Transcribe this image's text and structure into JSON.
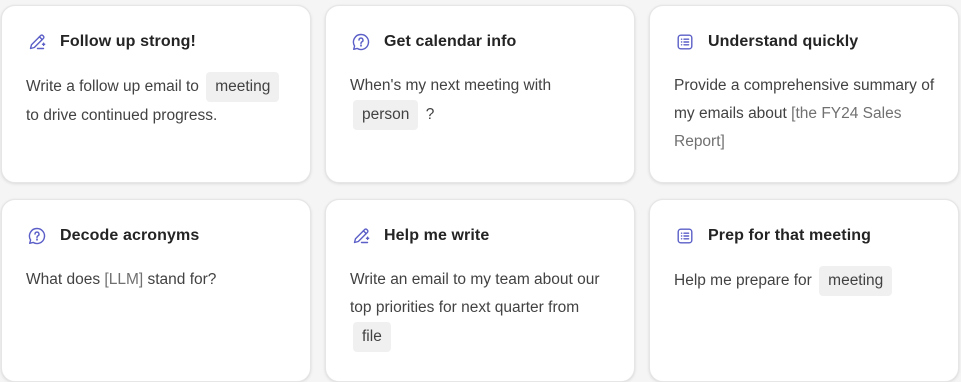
{
  "cards": [
    {
      "icon": "pen-sparkle-icon",
      "title": "Follow up strong!",
      "segments": [
        {
          "type": "text",
          "value": "Write a follow up email to"
        },
        {
          "type": "chip",
          "value": "meeting"
        },
        {
          "type": "text",
          "value": "to drive continued progress."
        }
      ]
    },
    {
      "icon": "chat-help-icon",
      "title": "Get calendar info",
      "segments": [
        {
          "type": "text",
          "value": "When's my next meeting with"
        },
        {
          "type": "chip",
          "value": "person"
        },
        {
          "type": "text",
          "value": "?"
        }
      ]
    },
    {
      "icon": "list-document-icon",
      "title": "Understand quickly",
      "segments": [
        {
          "type": "text",
          "value": "Provide a comprehensive summary of my emails about"
        },
        {
          "type": "placeholder",
          "value": "[the FY24 Sales Report]"
        }
      ]
    },
    {
      "icon": "chat-help-icon",
      "title": "Decode acronyms",
      "segments": [
        {
          "type": "text",
          "value": "What does"
        },
        {
          "type": "placeholder",
          "value": "[LLM]"
        },
        {
          "type": "text",
          "value": "stand for?"
        }
      ]
    },
    {
      "icon": "pen-sparkle-icon",
      "title": "Help me write",
      "segments": [
        {
          "type": "text",
          "value": "Write an email to my team about our top priorities for next quarter from"
        },
        {
          "type": "chip",
          "value": "file"
        }
      ]
    },
    {
      "icon": "list-document-icon",
      "title": "Prep for that meeting",
      "segments": [
        {
          "type": "text",
          "value": "Help me prepare for"
        },
        {
          "type": "chip",
          "value": "meeting"
        }
      ]
    }
  ],
  "colors": {
    "icon_accent": "#5b5fc7",
    "chip_background": "#f0f0f0",
    "placeholder_text": "#707070",
    "page_background": "#f5f5f5"
  }
}
